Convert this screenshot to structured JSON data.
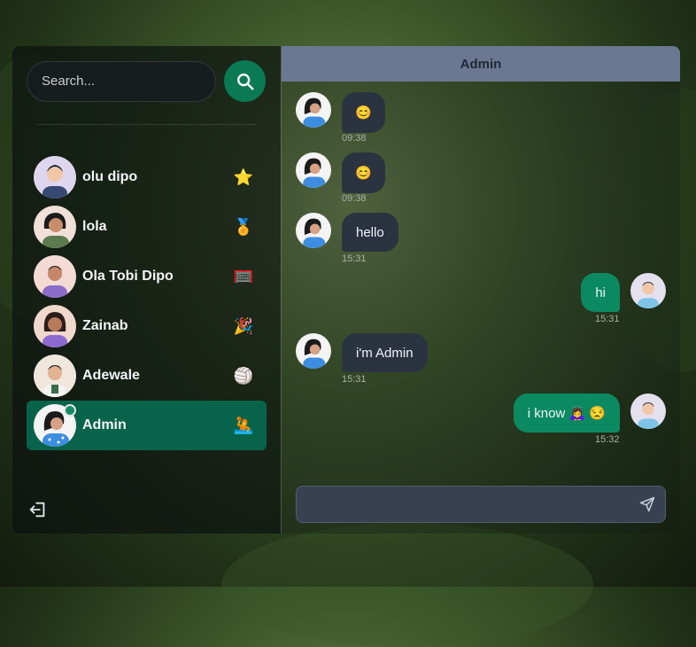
{
  "search": {
    "placeholder": "Search..."
  },
  "icons": {
    "search": "search-icon",
    "logout": "logout-icon",
    "send": "send-icon"
  },
  "colors": {
    "accent": "#0a7a55",
    "active_contact": "#07644a",
    "header": "#6a7891",
    "incoming": "#2b3340",
    "outgoing": "#0b8a62"
  },
  "contacts": [
    {
      "name": "olu dipo",
      "emoji": "⭐"
    },
    {
      "name": "lola",
      "emoji": "🏅"
    },
    {
      "name": "Ola Tobi Dipo",
      "emoji": "🥅"
    },
    {
      "name": "Zainab",
      "emoji": "🎉"
    },
    {
      "name": "Adewale",
      "emoji": "🏐"
    },
    {
      "name": "Admin",
      "emoji": "🤽"
    }
  ],
  "conversation": {
    "title": "Admin",
    "messages": [
      {
        "text": "😊",
        "time": "09:38",
        "from": "them"
      },
      {
        "text": "😊",
        "time": "09:38",
        "from": "them"
      },
      {
        "text": "hello",
        "time": "15:31",
        "from": "them"
      },
      {
        "text": "hi",
        "time": "15:31",
        "from": "me"
      },
      {
        "text": "i'm Admin",
        "time": "15:31",
        "from": "them"
      },
      {
        "text": "i know 🙇‍♀️ 😒",
        "time": "15:32",
        "from": "me"
      }
    ],
    "input_placeholder": ""
  }
}
